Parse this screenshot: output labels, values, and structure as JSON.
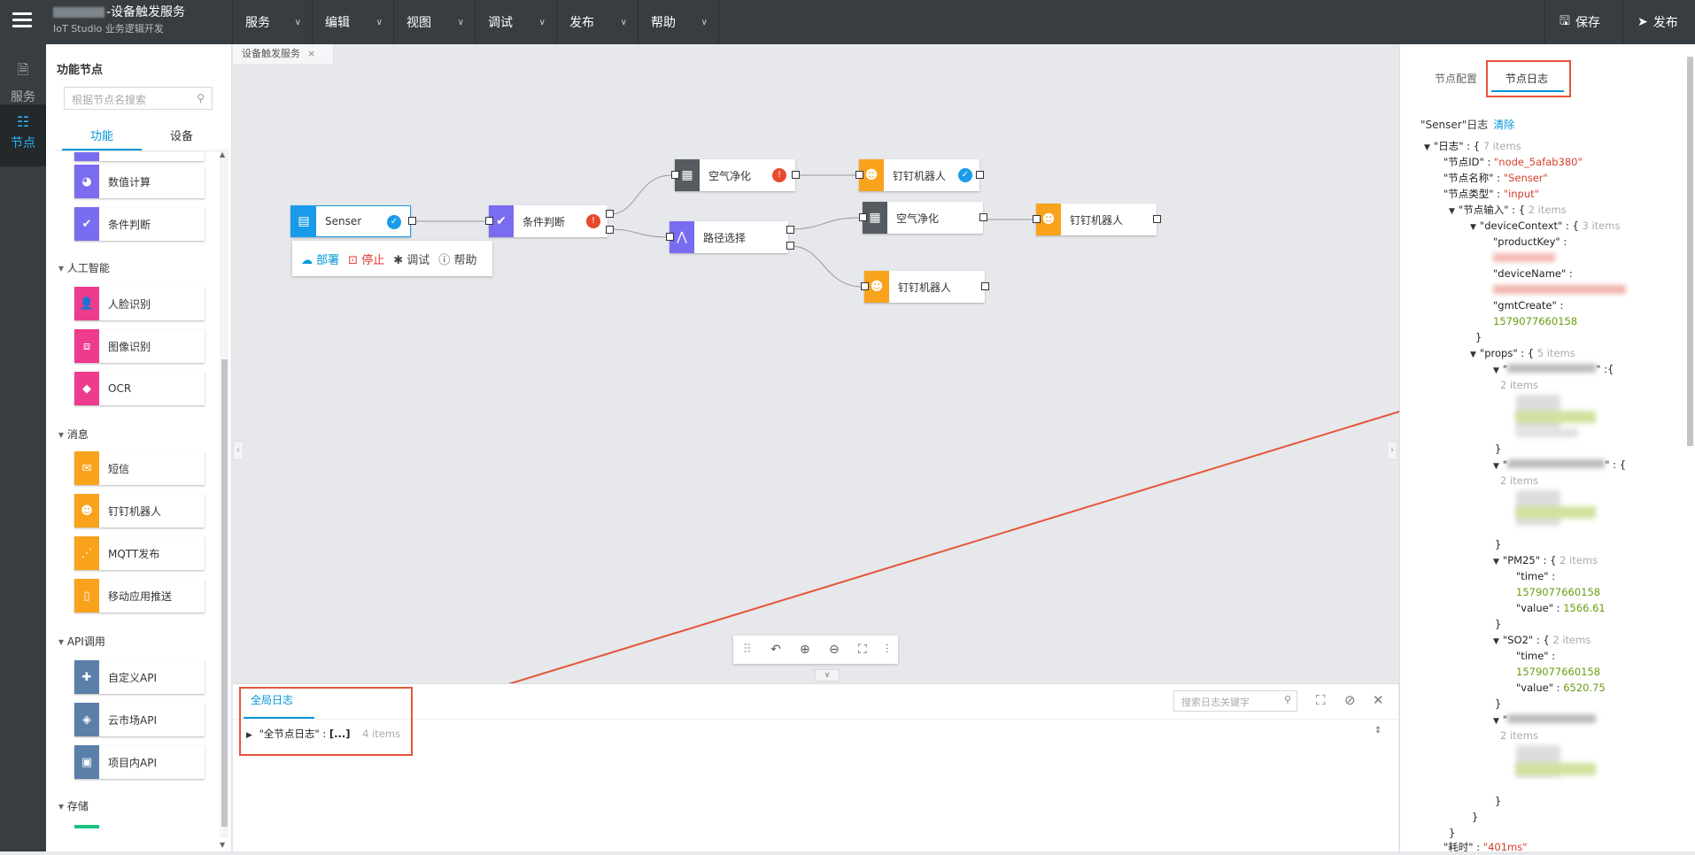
{
  "topbar": {
    "title": "-设备触发服务",
    "subtitle": "IoT Studio 业务逻辑开发",
    "menus": [
      "服务",
      "编辑",
      "视图",
      "调试",
      "发布",
      "帮助"
    ],
    "save_label": "保存",
    "publish_label": "发布"
  },
  "leftstrip": {
    "items": [
      {
        "label": "服务",
        "icon": "document-icon"
      },
      {
        "label": "节点",
        "icon": "node-icon"
      }
    ]
  },
  "panel": {
    "title": "功能节点",
    "search_placeholder": "根据节点名搜索",
    "tabs": [
      "功能",
      "设备"
    ],
    "categories": [
      {
        "name": "人工智能"
      },
      {
        "name": "消息"
      },
      {
        "name": "API调用"
      },
      {
        "name": "存储"
      }
    ],
    "nodes": [
      {
        "label": "数值计算",
        "color": "#7a6cf0"
      },
      {
        "label": "条件判断",
        "color": "#7a6cf0"
      },
      {
        "label": "人脸识别",
        "color": "#ee3b8c"
      },
      {
        "label": "图像识别",
        "color": "#ee3b8c"
      },
      {
        "label": "OCR",
        "color": "#ee3b8c"
      },
      {
        "label": "短信",
        "color": "#f9a21b"
      },
      {
        "label": "钉钉机器人",
        "color": "#f9a21b"
      },
      {
        "label": "MQTT发布",
        "color": "#f9a21b"
      },
      {
        "label": "移动应用推送",
        "color": "#f9a21b"
      },
      {
        "label": "自定义API",
        "color": "#5a7fa9"
      },
      {
        "label": "云市场API",
        "color": "#5a7fa9"
      },
      {
        "label": "项目内API",
        "color": "#5a7fa9"
      }
    ]
  },
  "canvas": {
    "doc_tab": "设备触发服务",
    "nodes": [
      {
        "label": "Senser",
        "color": "#1a9bea"
      },
      {
        "label": "条件判断",
        "color": "#7a6cf0"
      },
      {
        "label": "空气净化",
        "color": "#555b60"
      },
      {
        "label": "钉钉机器人",
        "color": "#f9a21b"
      },
      {
        "label": "路径选择",
        "color": "#7a6cf0"
      },
      {
        "label": "空气净化",
        "color": "#555b60"
      },
      {
        "label": "钉钉机器人",
        "color": "#f9a21b"
      },
      {
        "label": "钉钉机器人",
        "color": "#f9a21b"
      }
    ],
    "actions": {
      "deploy": "部署",
      "stop": "停止",
      "debug": "调试",
      "help": "帮助"
    }
  },
  "bottom": {
    "tab": "全局日志",
    "search_placeholder": "搜索日志关键字",
    "log_key": "\"全节点日志\"",
    "log_value": "[...]",
    "log_count": "4 items"
  },
  "right": {
    "tabs": [
      "节点配置",
      "节点日志"
    ],
    "title": "\"Senser\"日志",
    "clear": "清除",
    "json": {
      "log_key": "\"日志\"",
      "log_count": "7 items",
      "node_id_key": "\"节点ID\"",
      "node_id_val": "\"node_5afab380\"",
      "node_name_key": "\"节点名称\"",
      "node_name_val": "\"Senser\"",
      "node_type_key": "\"节点类型\"",
      "node_type_val": "\"input\"",
      "node_input_key": "\"节点输入\"",
      "node_input_count": "2 items",
      "device_ctx_key": "\"deviceContext\"",
      "device_ctx_count": "3 items",
      "product_key": "\"productKey\"",
      "device_name": "\"deviceName\"",
      "gmt_create": "\"gmtCreate\"",
      "gmt_create_val": "1579077660158",
      "props_key": "\"props\"",
      "props_count": "5 items",
      "pm25_key": "\"PM25\"",
      "pm25_count": "2 items",
      "time_key": "\"time\"",
      "pm25_time": "1579077660158",
      "value_key": "\"value\"",
      "pm25_value": "1566.61",
      "so2_key": "\"SO2\"",
      "so2_count": "2 items",
      "so2_time": "1579077660158",
      "so2_value": "6520.75",
      "elapsed_key": "\"耗时\"",
      "elapsed_val": "\"401ms\"",
      "items2": "2 items"
    }
  }
}
